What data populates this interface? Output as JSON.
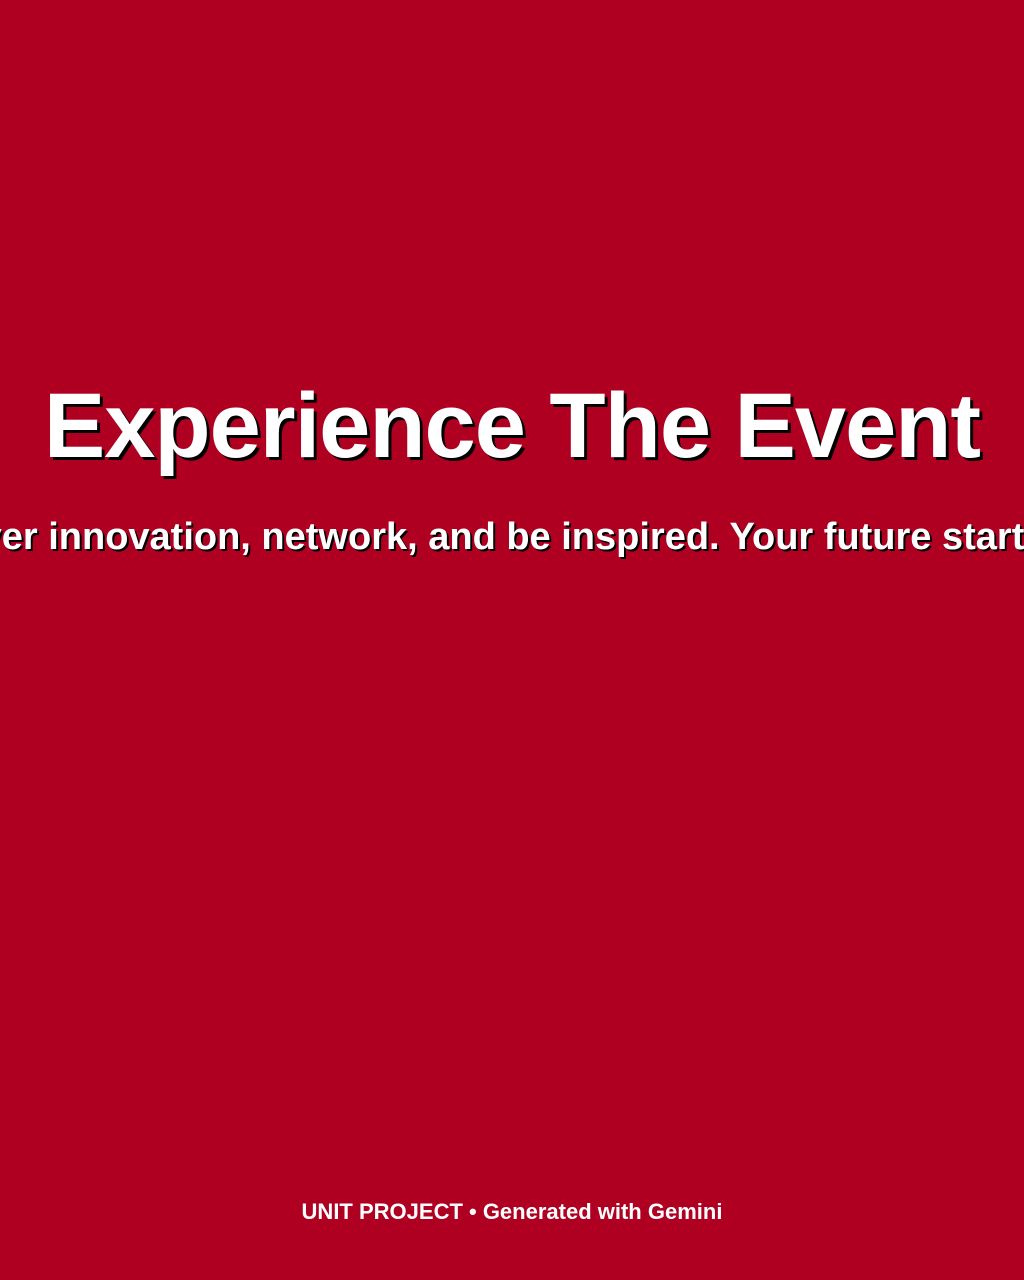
{
  "theme": {
    "background": "#b00022",
    "text": "#ffffff",
    "shadow": "#000000"
  },
  "hero": {
    "title": "Experience The Event",
    "subtitle": "Discover innovation, network, and be inspired. Your future starts here."
  },
  "footer": {
    "credit": "UNIT PROJECT • Generated with Gemini"
  }
}
